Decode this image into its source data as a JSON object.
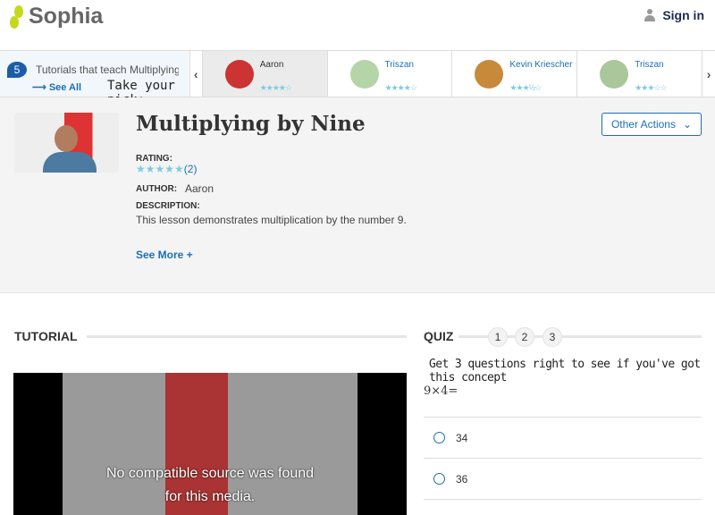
{
  "header": {
    "logo": "Sophia",
    "sign_in": "Sign in"
  },
  "carousel": {
    "count": "5",
    "intro": "Tutorials that teach Multiplying by Nine",
    "see_all": "See All",
    "pick": "Take your pick:",
    "cards": [
      {
        "name": "Aaron",
        "stars": "★★★★☆",
        "rating": 4.5,
        "color": "#c33"
      },
      {
        "name": "Triszan",
        "stars": "★★★★☆",
        "rating": 4,
        "color": "#b5d4a8"
      },
      {
        "name": "Kevin Kriescher",
        "stars": "★★★½☆",
        "rating": 3.5,
        "color": "#c68a3a"
      },
      {
        "name": "Triszan",
        "stars": "★★★☆☆",
        "rating": 3,
        "color": "#a9c79a"
      }
    ]
  },
  "lesson": {
    "title": "Multiplying by Nine",
    "rating_label": "RATING:",
    "stars": "★★★★★",
    "rating_count": "(2)",
    "author_label": "AUTHOR:",
    "author": "Aaron",
    "description_label": "DESCRIPTION:",
    "description": "This lesson demonstrates multiplication by the number 9.",
    "see_more": "See More +",
    "other_actions": "Other Actions"
  },
  "tutorial": {
    "heading": "TUTORIAL",
    "video_message_1": "No compatible source was found",
    "video_message_2": "for this media."
  },
  "quiz": {
    "heading": "QUIZ",
    "steps": [
      "1",
      "2",
      "3"
    ],
    "prompt": "Get 3 questions right to see if you've got this concept",
    "question": "9×4=",
    "options": [
      "34",
      "36"
    ]
  }
}
